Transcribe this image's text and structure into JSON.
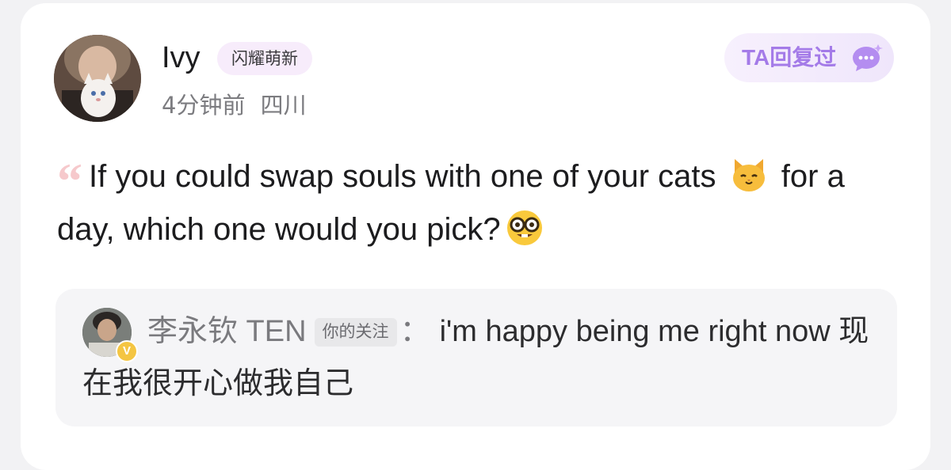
{
  "post": {
    "author": {
      "name": "Ivy",
      "badge": "闪耀萌新",
      "time": "4分钟前",
      "location": "四川"
    },
    "replied_badge": {
      "label": "TA回复过",
      "icon": "chat-bubble-icon"
    },
    "question": {
      "quote_icon": "open-quote-icon",
      "text_part1": "If you could swap souls with one of your cats",
      "emoji_cat": "cat-face-emoji",
      "text_part2": "for a day, which one would you pick?",
      "emoji_nerd": "nerd-face-emoji"
    }
  },
  "reply": {
    "author": "李永钦 TEN",
    "tag": "你的关注",
    "separator": "：",
    "text": "i'm happy being me right now 现在我很开心做我自己",
    "verified_mark": "V"
  },
  "colors": {
    "accent_purple": "#a47be8",
    "badge_bg": "#f7ecfb",
    "quote_pink": "#f6c9cc",
    "verified_gold": "#f4c542"
  }
}
